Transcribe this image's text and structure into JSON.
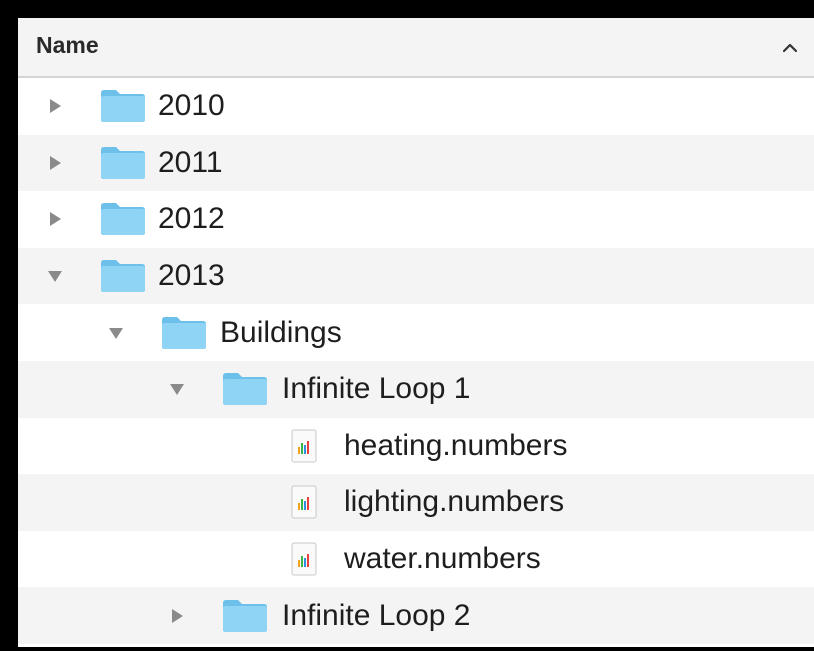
{
  "header": {
    "column_name": "Name",
    "sort_icon": "chevron-up-icon"
  },
  "rows": [
    {
      "label": "2010",
      "type": "folder",
      "expanded": false
    },
    {
      "label": "2011",
      "type": "folder",
      "expanded": false
    },
    {
      "label": "2012",
      "type": "folder",
      "expanded": false
    },
    {
      "label": "2013",
      "type": "folder",
      "expanded": true
    },
    {
      "label": "Buildings",
      "type": "folder",
      "expanded": true
    },
    {
      "label": "Infinite Loop 1",
      "type": "folder",
      "expanded": true
    },
    {
      "label": "heating.numbers",
      "type": "numbers-file"
    },
    {
      "label": "lighting.numbers",
      "type": "numbers-file"
    },
    {
      "label": "water.numbers",
      "type": "numbers-file"
    },
    {
      "label": "Infinite Loop 2",
      "type": "folder",
      "expanded": false
    }
  ],
  "colors": {
    "folder": "#7fcdf2",
    "folder_tab": "#6cc0ea",
    "disclosure": "#8a8a8a",
    "alt_row": "#f4f4f4"
  }
}
